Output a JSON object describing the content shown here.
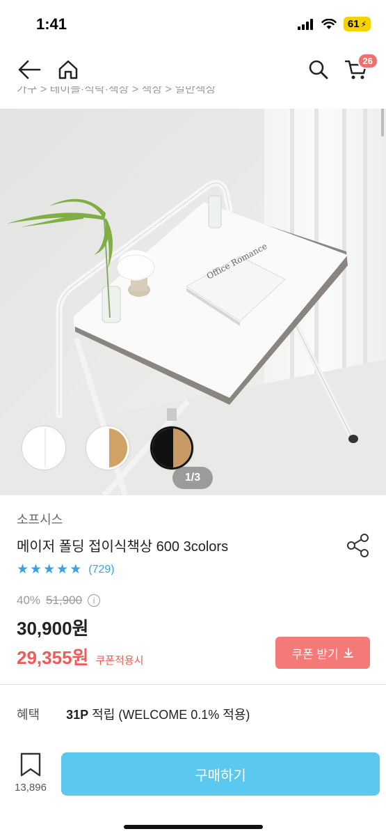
{
  "status": {
    "time": "1:41",
    "battery": "61"
  },
  "nav": {
    "cart_count": "26"
  },
  "breadcrumb": "가구 > 테이블·식탁·책상 > 책상 > 일반책상",
  "gallery": {
    "counter": "1/3",
    "swatches": [
      "white",
      "white-wood",
      "black-wood"
    ],
    "selected_swatch": 2,
    "book_text": "Office Romance"
  },
  "product": {
    "brand": "소프시스",
    "title": "메이저 폴딩 접이식책상 600 3colors",
    "rating_stars": 5,
    "review_count": "(729)",
    "discount": "40%",
    "original_price": "51,900",
    "sale_price": "30,900원",
    "coupon_price": "29,355원",
    "coupon_note": "쿠폰적용시",
    "coupon_button": "쿠폰 받기"
  },
  "benefit": {
    "label": "혜택",
    "points": "31P",
    "text": " 적립 (WELCOME 0.1% 적용)"
  },
  "bottom": {
    "wishlist_count": "13,896",
    "buy_label": "구매하기"
  },
  "colors": {
    "accent": "#5bc8f0",
    "coupon": "#ef5b57",
    "star": "#3aa0e6",
    "badge": "#ef6f6c"
  }
}
